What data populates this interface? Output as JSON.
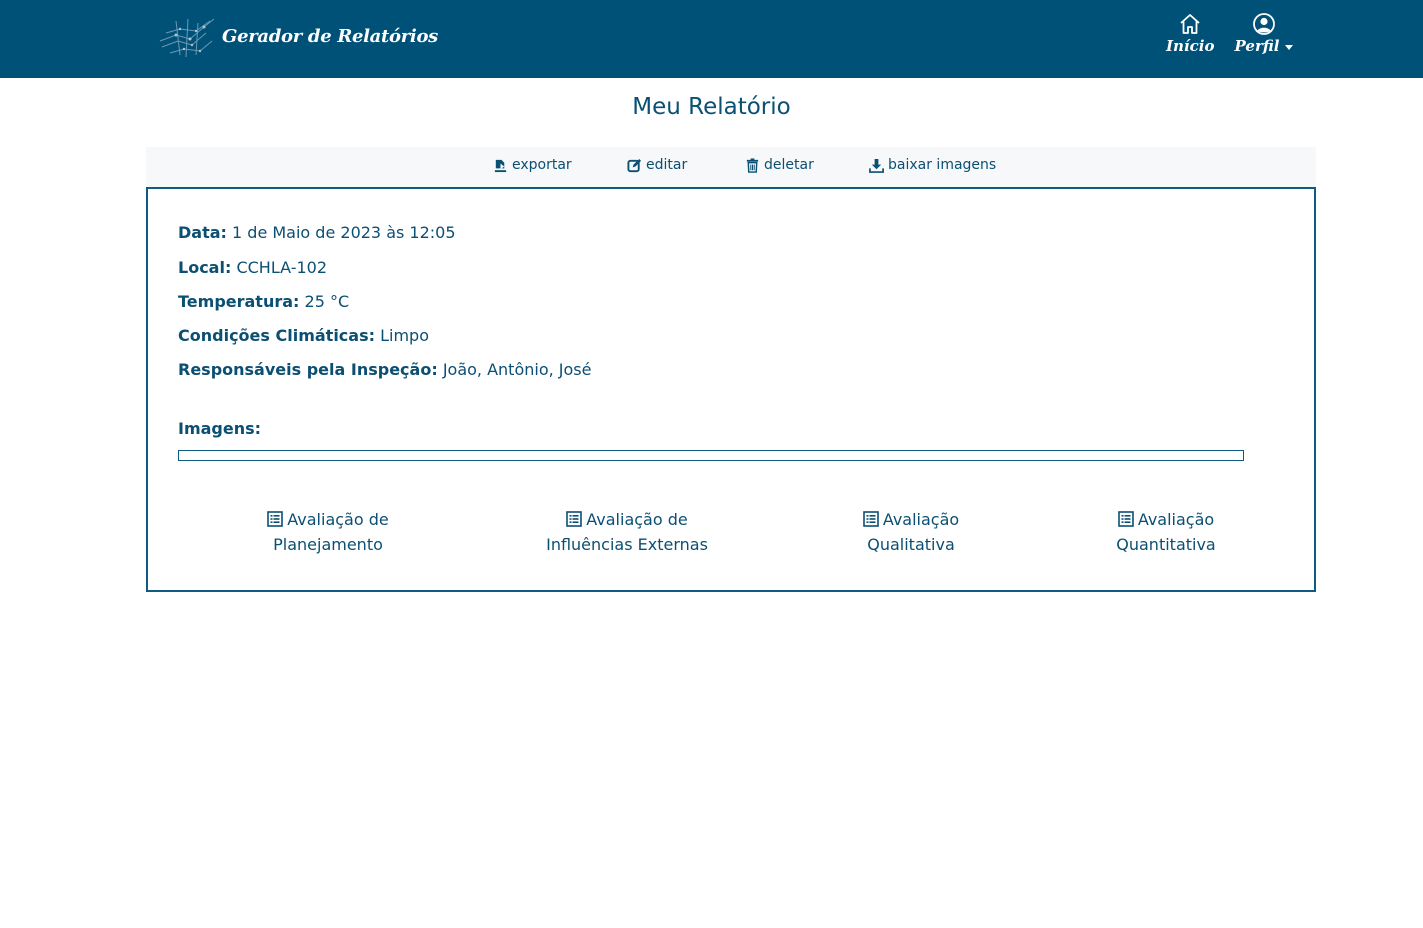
{
  "header": {
    "brand": "Gerador de Relatórios",
    "nav": {
      "home_label": "Início",
      "home_icon": "home-icon",
      "profile_label": "Perfil",
      "profile_icon": "user-circle-icon"
    }
  },
  "page": {
    "title": "Meu Relatório"
  },
  "toolbar": {
    "export_label": "exportar",
    "edit_label": "editar",
    "delete_label": "deletar",
    "download_label": "baixar imagens"
  },
  "report": {
    "fields": [
      {
        "label": "Data:",
        "value": "1 de Maio de 2023 às 12:05"
      },
      {
        "label": "Local:",
        "value": "CCHLA-102"
      },
      {
        "label": "Temperatura:",
        "value": "25 °C"
      },
      {
        "label": "Condições Climáticas:",
        "value": "Limpo"
      },
      {
        "label": "Responsáveis pela Inspeção:",
        "value": "João, Antônio, José"
      }
    ],
    "images_label": "Imagens:",
    "evaluations": [
      {
        "line1": "Avaliação de",
        "line2": "Planejamento"
      },
      {
        "line1": "Avaliação de",
        "line2": "Influências Externas"
      },
      {
        "line1": "Avaliação",
        "line2": "Qualitativa"
      },
      {
        "line1": "Avaliação",
        "line2": "Quantitativa"
      }
    ]
  },
  "colors": {
    "header_bg": "#005178",
    "accent": "#0b4f73",
    "toolbar_bg": "#f6f8f9"
  }
}
